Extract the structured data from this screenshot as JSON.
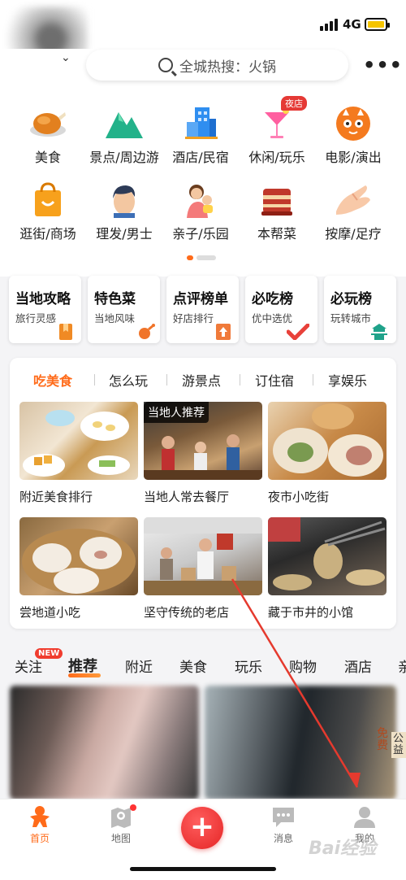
{
  "status": {
    "network": "4G"
  },
  "header": {
    "search_placeholder": "全城热搜：火锅"
  },
  "categories": [
    {
      "label": "美食",
      "icon": "roast-chicken-icon"
    },
    {
      "label": "景点/周边游",
      "icon": "mountain-icon"
    },
    {
      "label": "酒店/民宿",
      "icon": "hotel-building-icon"
    },
    {
      "label": "休闲/玩乐",
      "icon": "cocktail-icon",
      "badge": "夜店"
    },
    {
      "label": "电影/演出",
      "icon": "cat-face-icon"
    },
    {
      "label": "逛街/商场",
      "icon": "shopping-bag-icon"
    },
    {
      "label": "理发/男士",
      "icon": "man-head-icon"
    },
    {
      "label": "亲子/乐园",
      "icon": "parent-child-icon"
    },
    {
      "label": "本帮菜",
      "icon": "braised-pork-icon"
    },
    {
      "label": "按摩/足疗",
      "icon": "massage-hand-icon"
    }
  ],
  "quick_cards": [
    {
      "title": "当地攻略",
      "sub": "旅行灵感",
      "color": "#f08a24"
    },
    {
      "title": "特色菜",
      "sub": "当地风味",
      "color": "#f0742a"
    },
    {
      "title": "点评榜单",
      "sub": "好店排行",
      "color": "#f07a3a"
    },
    {
      "title": "必吃榜",
      "sub": "优中选优",
      "color": "#e8413a"
    },
    {
      "title": "必玩榜",
      "sub": "玩转城市",
      "color": "#1fa28a"
    }
  ],
  "panel": {
    "tabs": [
      "吃美食",
      "怎么玩",
      "游景点",
      "订住宿",
      "享娱乐"
    ],
    "local_tag": "当地人推荐",
    "tiles": [
      "附近美食排行",
      "当地人常去餐厅",
      "夜市小吃街",
      "尝地道小吃",
      "坚守传统的老店",
      "藏于市井的小馆"
    ]
  },
  "feed_tabs": [
    "关注",
    "推荐",
    "附近",
    "美食",
    "玩乐",
    "购物",
    "酒店",
    "亲"
  ],
  "new_badge": "NEW",
  "feed_side": {
    "mian": "免费",
    "gongyi": "公益"
  },
  "bottom_nav": {
    "home": "首页",
    "map": "地图",
    "messages": "消息",
    "mine": "我的"
  },
  "plus_label": "+",
  "watermark": "Bai经验",
  "colors": {
    "accent": "#ff6b1a",
    "plus": "#e52525"
  }
}
